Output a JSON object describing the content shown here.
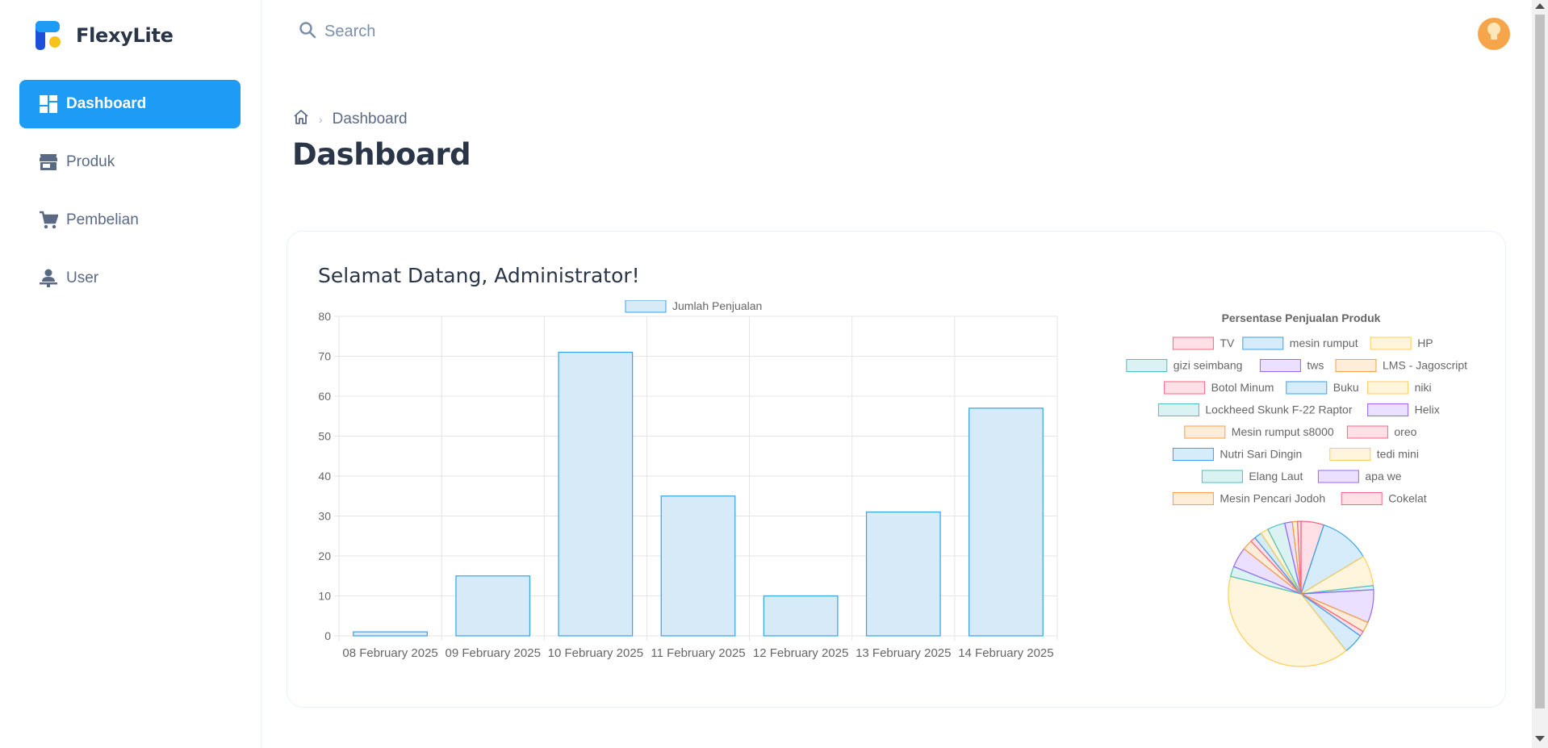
{
  "app": {
    "name": "FlexyLite"
  },
  "sidebar": {
    "items": [
      {
        "label": "Dashboard",
        "icon": "dashboard-icon",
        "active": true
      },
      {
        "label": "Produk",
        "icon": "store-icon",
        "active": false
      },
      {
        "label": "Pembelian",
        "icon": "cart-icon",
        "active": false
      },
      {
        "label": "User",
        "icon": "user-icon",
        "active": false
      }
    ]
  },
  "header": {
    "search": {
      "placeholder": "Search",
      "icon": "search-icon"
    },
    "avatar": {
      "icon": "lightbulb-icon",
      "color": "#f6a54b"
    }
  },
  "breadcrumb": {
    "home_icon": "home-icon",
    "current": "Dashboard"
  },
  "page": {
    "title": "Dashboard"
  },
  "card": {
    "welcome": "Selamat Datang, Administrator!"
  },
  "colors": {
    "accent": "#1e9bf4",
    "bar_fill": "#d6eaf8",
    "bar_border": "#36a2eb"
  },
  "chart_data": [
    {
      "type": "bar",
      "categories": [
        "08 February 2025",
        "09 February 2025",
        "10 February 2025",
        "11 February 2025",
        "12 February 2025",
        "13 February 2025",
        "14 February 2025"
      ],
      "series": [
        {
          "name": "Jumlah Penjualan",
          "values": [
            1,
            15,
            71,
            35,
            10,
            31,
            57
          ]
        }
      ],
      "ylim": [
        0,
        80
      ],
      "yticks": [
        0,
        10,
        20,
        30,
        40,
        50,
        60,
        70,
        80
      ],
      "grid": true,
      "legend": "top"
    },
    {
      "type": "pie",
      "title": "Persentase Penjualan Produk",
      "legend": "top",
      "labels": [
        "TV",
        "mesin rumput",
        "HP",
        "gizi seimbang",
        "tws",
        "LMS - Jagoscript",
        "Botol Minum",
        "Buku",
        "niki",
        "Lockheed Skunk F-22 Raptor",
        "Helix",
        "Mesin rumput s8000",
        "oreo",
        "Nutri Sari Dingin",
        "tedi mini",
        "Elang Laut",
        "apa we",
        "Mesin Pencari Jodoh",
        "Cokelat"
      ],
      "values": [
        4.5,
        10,
        6,
        0.8,
        6.5,
        2,
        1,
        4,
        35,
        2,
        4,
        2,
        1,
        1.5,
        1.5,
        3.5,
        1.5,
        1,
        0.7
      ],
      "colors": [
        "#ff6384",
        "#36a2eb",
        "#ffcd56",
        "#4bc0c0",
        "#9966ff",
        "#ff9f40"
      ]
    }
  ]
}
